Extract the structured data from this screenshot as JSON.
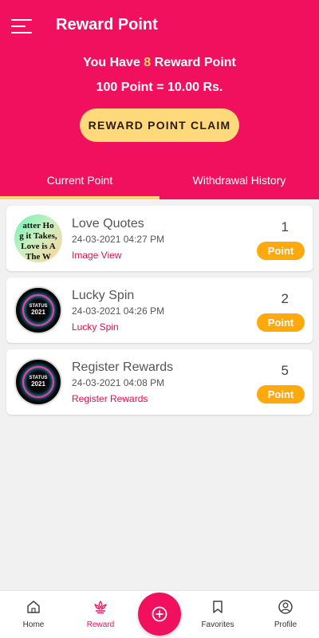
{
  "header": {
    "title": "Reward Point",
    "summary_prefix": "You Have ",
    "points_count": "8",
    "summary_suffix": " Reward Point",
    "rate": "100 Point = 10.00 Rs.",
    "claim_button": "REWARD POINT CLAIM",
    "bg_color": "#f0105e",
    "accent_color": "#ffd56e"
  },
  "tabs": [
    {
      "label": "Current Point",
      "active": true
    },
    {
      "label": "Withdrawal History",
      "active": false
    }
  ],
  "entries": [
    {
      "title": "Love Quotes",
      "datetime": "24-03-2021  04:27 PM",
      "link": "Image View",
      "points": "1",
      "badge": "Point",
      "thumb_lines": [
        "atter Ho",
        "g it Takes,",
        "Love is A",
        "The W"
      ]
    },
    {
      "title": "Lucky Spin",
      "datetime": "24-03-2021  04:26 PM",
      "link": "Lucky Spin",
      "points": "2",
      "badge": "Point",
      "thumb_lines": [
        "STATUS",
        "2021"
      ]
    },
    {
      "title": "Register Rewards",
      "datetime": "24-03-2021  04:08 PM",
      "link": "Register Rewards",
      "points": "5",
      "badge": "Point",
      "thumb_lines": [
        "STATUS",
        "2021"
      ]
    }
  ],
  "bottom_nav": [
    {
      "label": "Home",
      "icon": "home-icon",
      "active": false
    },
    {
      "label": "Reward",
      "icon": "reward-icon",
      "active": true
    },
    {
      "label": "Favorites",
      "icon": "bookmark-icon",
      "active": false
    },
    {
      "label": "Profile",
      "icon": "profile-icon",
      "active": false
    }
  ],
  "fab_icon": "add-circle-icon"
}
